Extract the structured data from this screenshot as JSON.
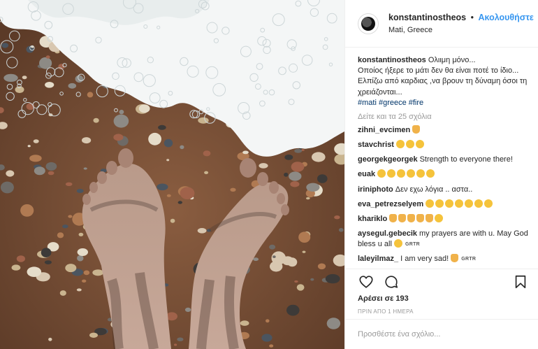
{
  "post": {
    "username": "konstantinostheos",
    "separator": "•",
    "follow_label": "Ακολουθήστε",
    "location": "Mati, Greece",
    "caption_text": "Ολιιμη μόνο...\nΟποίος ήξερε το μάτι δεν θα είναι ποτέ το ίδιο...\nΕλπίζω από καρδιας ,να βρουν τη δύναμη όσοι τη χρειάζονται...",
    "hashtags": "#mati #greece #fire",
    "view_all_comments": "Δείτε και τα 25 σχόλια",
    "likes": "Αρέσει σε 193",
    "timestamp": "ΠΡΙΝ ΑΠΟ 1 ΗΜΕΡΑ",
    "comment_placeholder": "Προσθέστε ένα σχόλιο..."
  },
  "comments": [
    {
      "user": "zihni_evcimen",
      "text": "",
      "emojis": [
        "pray"
      ]
    },
    {
      "user": "stavchrist",
      "text": "",
      "emojis": [
        "sad",
        "sad",
        "sad"
      ]
    },
    {
      "user": "georgekgeorgek",
      "text": "Strength to everyone there!",
      "emojis": []
    },
    {
      "user": "euak",
      "text": "",
      "emojis": [
        "sad",
        "sad",
        "sad",
        "sad",
        "sad",
        "sad"
      ]
    },
    {
      "user": "iriniphoto",
      "text": "Δεν εχω λόγια .. αστα..",
      "emojis": []
    },
    {
      "user": "eva_petrezselyem",
      "text": "",
      "emojis": [
        "sad",
        "sad",
        "sad",
        "sad",
        "sad",
        "sad",
        "sad"
      ]
    },
    {
      "user": "khariklo",
      "text": "",
      "emojis": [
        "pray",
        "pray",
        "pray",
        "pray",
        "pray",
        "sad"
      ]
    },
    {
      "user": "aysegul.gebecik",
      "text": "my prayers are with u. May God bless u all",
      "emojis": [
        "sad"
      ],
      "suffix": "GRTR"
    },
    {
      "user": "laleyilmaz_",
      "text": "I am very sad!",
      "emojis": [
        "pray"
      ],
      "suffix": "GRTR"
    }
  ],
  "icons": {
    "like": "heart-icon",
    "comment": "comment-bubble-icon",
    "save": "bookmark-icon",
    "avatar": "profile-avatar"
  },
  "colors": {
    "link": "#3897f0",
    "hashtag": "#003569",
    "muted": "#999999",
    "text": "#262626"
  }
}
